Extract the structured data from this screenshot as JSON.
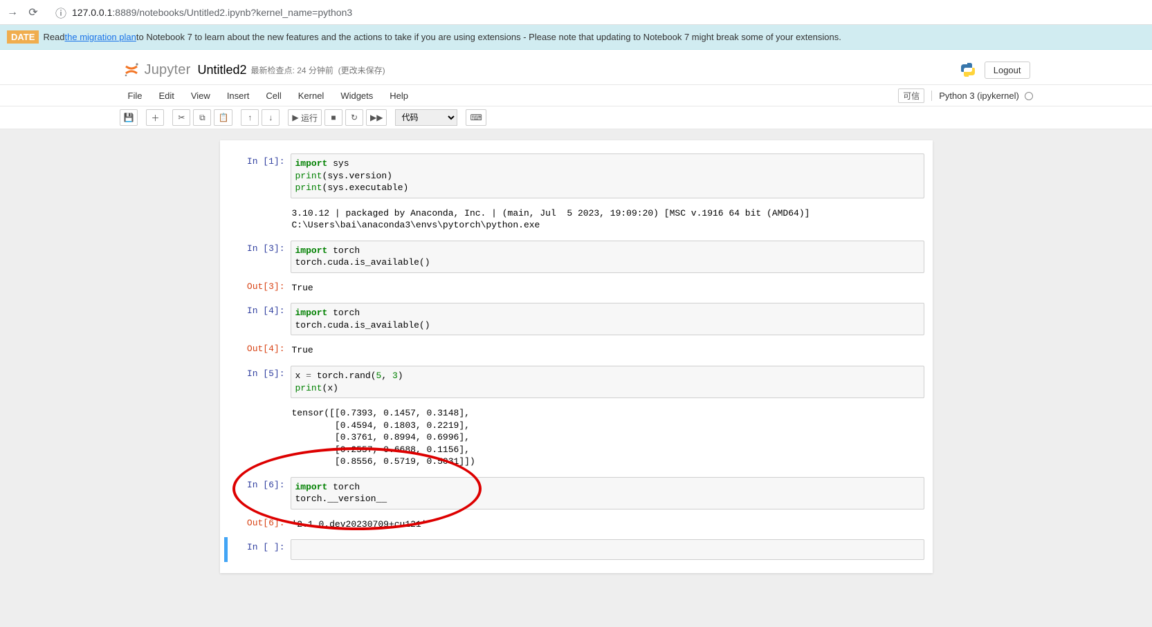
{
  "browser": {
    "url_prefix": "127.0.0.1",
    "url_rest": ":8889/notebooks/Untitled2.ipynb?kernel_name=python3"
  },
  "banner": {
    "tag": "DATE",
    "t1": "Read ",
    "link": "the migration plan",
    "t2": " to Notebook 7 to learn about the new features and the actions to take if you are using extensions - Please note that updating to Notebook 7 might break some of your extensions."
  },
  "header": {
    "logo": "Jupyter",
    "notebook_name": "Untitled2",
    "checkpoint": "最新检查点: 24 分钟前",
    "unsaved": "(更改未保存)",
    "logout": "Logout"
  },
  "menu": {
    "file": "File",
    "edit": "Edit",
    "view": "View",
    "insert": "Insert",
    "cell": "Cell",
    "kernel": "Kernel",
    "widgets": "Widgets",
    "help": "Help",
    "trusted": "可信",
    "kernel_name": "Python 3 (ipykernel)"
  },
  "toolbar": {
    "run": "运行",
    "celltype": "代码"
  },
  "cells": [
    {
      "in_n": "1",
      "code_html": "<span class='kw'>import</span> <span class='nm'>sys</span>\n<span class='bi'>print</span>(sys.version)\n<span class='bi'>print</span>(sys.executable)",
      "stream": "3.10.12 | packaged by Anaconda, Inc. | (main, Jul  5 2023, 19:09:20) [MSC v.1916 64 bit (AMD64)]\nC:\\Users\\bai\\anaconda3\\envs\\pytorch\\python.exe"
    },
    {
      "in_n": "3",
      "code_html": "<span class='kw'>import</span> <span class='nm'>torch</span>\ntorch.cuda.is_available()",
      "out_n": "3",
      "out_text": "True"
    },
    {
      "in_n": "4",
      "code_html": "<span class='kw'>import</span> <span class='nm'>torch</span>\ntorch.cuda.is_available()",
      "out_n": "4",
      "out_text": "True"
    },
    {
      "in_n": "5",
      "code_html": "x <span class='op'>=</span> torch.rand(<span class='num'>5</span>, <span class='num'>3</span>)\n<span class='bi'>print</span>(x)",
      "stream": "tensor([[0.7393, 0.1457, 0.3148],\n        [0.4594, 0.1803, 0.2219],\n        [0.3761, 0.8994, 0.6996],\n        [0.2557, 0.6688, 0.1156],\n        [0.8556, 0.5719, 0.5031]])"
    },
    {
      "in_n": "6",
      "code_html": "<span class='kw'>import</span> <span class='nm'>torch</span>\ntorch.__version__",
      "out_n": "6",
      "out_text": "'2.1.0.dev20230709+cu121'"
    }
  ],
  "empty_prompt": "In [ ]:"
}
